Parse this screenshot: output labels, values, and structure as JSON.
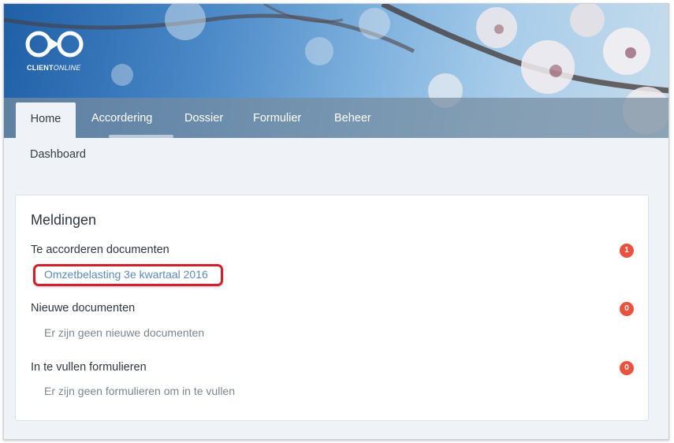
{
  "app": {
    "logo_text_bold": "CLIENT",
    "logo_text_light": "ONLINE"
  },
  "nav": {
    "tabs": [
      {
        "label": "Home",
        "active": true
      },
      {
        "label": "Accordering",
        "active": false
      },
      {
        "label": "Dossier",
        "active": false
      },
      {
        "label": "Formulier",
        "active": false
      },
      {
        "label": "Beheer",
        "active": false
      }
    ],
    "subnav": "Dashboard"
  },
  "panel": {
    "title": "Meldingen",
    "sections": [
      {
        "label": "Te accorderen documenten",
        "count": "1",
        "item": "Omzetbelasting 3e kwartaal 2016"
      },
      {
        "label": "Nieuwe documenten",
        "count": "0",
        "item": "Er zijn geen nieuwe documenten"
      },
      {
        "label": "In te vullen formulieren",
        "count": "0",
        "item": "Er zijn geen formulieren om in te vullen"
      }
    ]
  },
  "colors": {
    "badge": "#e8523f",
    "link": "#5b8bb8",
    "highlight": "#d0212a"
  }
}
